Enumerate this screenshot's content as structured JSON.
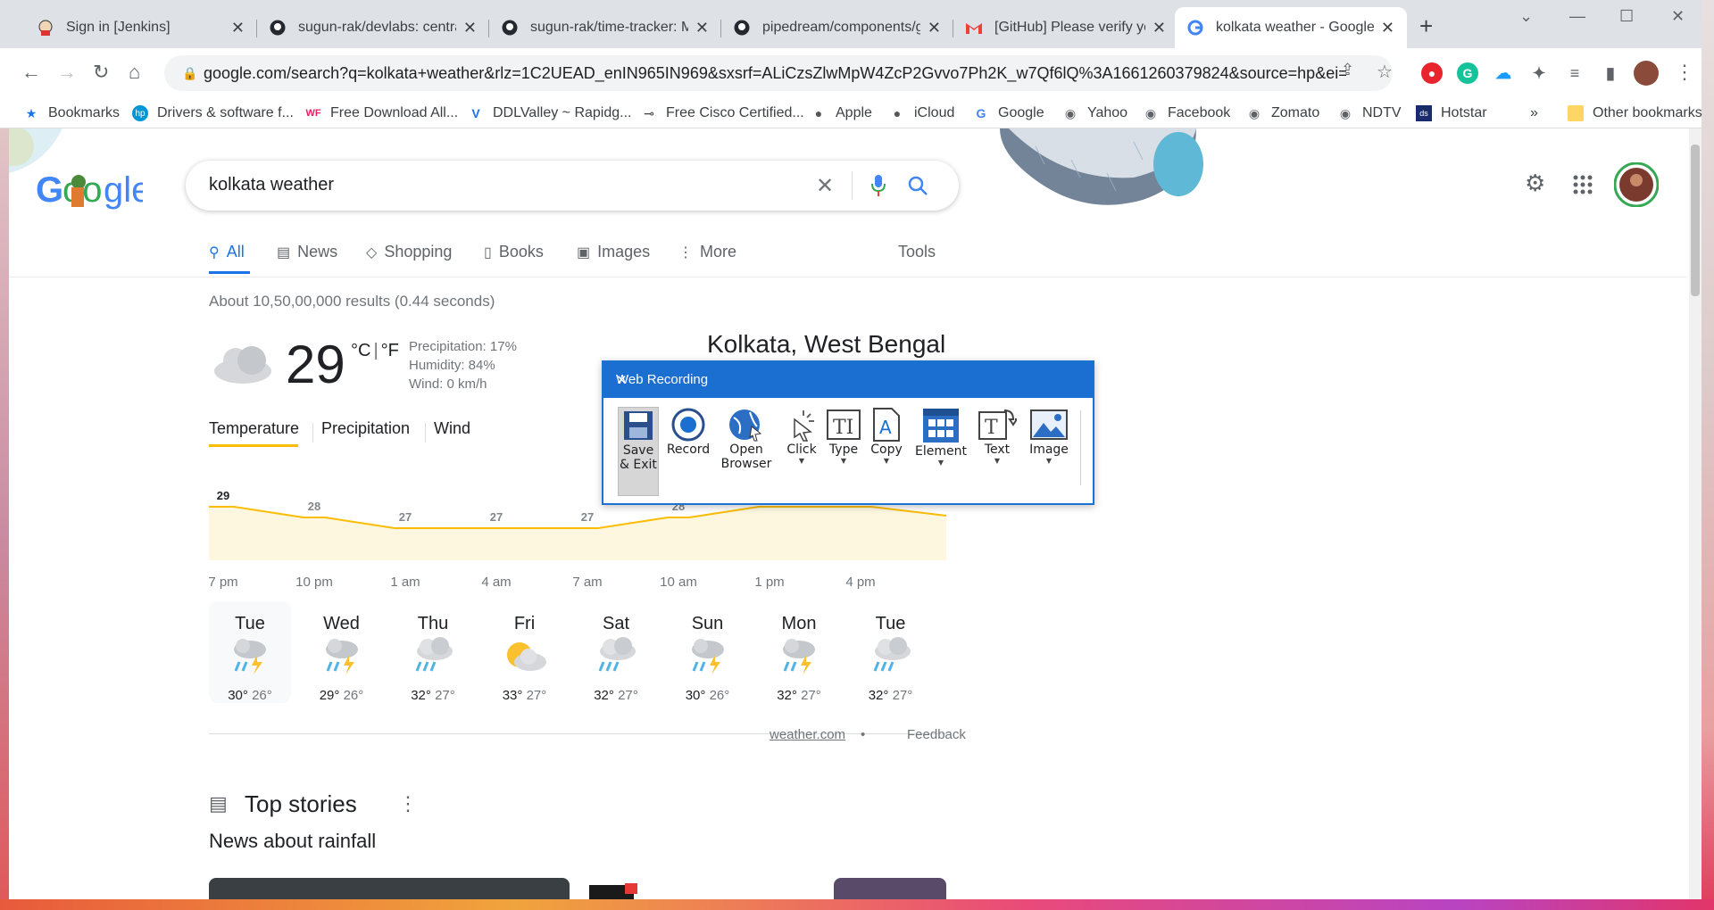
{
  "tabs": [
    {
      "title": "Sign in [Jenkins]",
      "icon": "jenkins-icon"
    },
    {
      "title": "sugun-rak/devlabs: central",
      "icon": "github-icon"
    },
    {
      "title": "sugun-rak/time-tracker: M",
      "icon": "github-icon"
    },
    {
      "title": "pipedream/components/g",
      "icon": "github-icon"
    },
    {
      "title": "[GitHub] Please verify your",
      "icon": "gmail-icon"
    },
    {
      "title": "kolkata weather - Google S",
      "icon": "google-icon"
    }
  ],
  "address": {
    "url": "google.com/search?q=kolkata+weather&rlz=1C2UEAD_enIN965IN969&sxsrf=ALiCzsZlwMpW4ZcP2Gvvo7Ph2K_w7Qf6lQ%3A1661260379824&source=hp&ei=W..."
  },
  "bookmarks": [
    {
      "label": "Bookmarks",
      "icon": "star-icon"
    },
    {
      "label": "Drivers & software f...",
      "icon": "hp-icon"
    },
    {
      "label": "Free Download All...",
      "icon": "wf-icon"
    },
    {
      "label": "DDLValley ~ Rapidg...",
      "icon": "v-icon"
    },
    {
      "label": "Free Cisco Certified...",
      "icon": "key-icon"
    },
    {
      "label": "Apple",
      "icon": "apple-icon"
    },
    {
      "label": "iCloud",
      "icon": "apple-icon"
    },
    {
      "label": "Google",
      "icon": "google-icon"
    },
    {
      "label": "Yahoo",
      "icon": "globe-icon"
    },
    {
      "label": "Facebook",
      "icon": "globe-icon"
    },
    {
      "label": "Zomato",
      "icon": "globe-icon"
    },
    {
      "label": "NDTV",
      "icon": "globe-icon"
    },
    {
      "label": "Hotstar",
      "icon": "hotstar-icon"
    }
  ],
  "bookmarks_more": "»",
  "other_bookmarks": "Other bookmarks",
  "search": {
    "query": "kolkata weather"
  },
  "nav_tabs": [
    {
      "label": "All",
      "icon": "search-icon"
    },
    {
      "label": "News",
      "icon": "news-icon"
    },
    {
      "label": "Shopping",
      "icon": "tag-icon"
    },
    {
      "label": "Books",
      "icon": "book-icon"
    },
    {
      "label": "Images",
      "icon": "image-icon"
    },
    {
      "label": "More",
      "icon": "kebab-icon"
    }
  ],
  "tools_label": "Tools",
  "result_stats": "About 10,50,00,000 results (0.44 seconds)",
  "weather": {
    "temperature": "29",
    "unit_c": "°C",
    "unit_sep": "|",
    "unit_f": "°F",
    "precipitation": "Precipitation: 17%",
    "humidity": "Humidity: 84%",
    "wind": "Wind: 0 km/h",
    "location": "Kolkata, West Bengal",
    "tabs": [
      "Temperature",
      "Precipitation",
      "Wind"
    ],
    "chart_points": [
      29,
      28,
      27,
      27,
      27,
      28,
      29,
      29
    ],
    "hour_labels": [
      "7 pm",
      "10 pm",
      "1 am",
      "4 am",
      "7 am",
      "10 am",
      "1 pm",
      "4 pm"
    ],
    "days": [
      {
        "name": "Tue",
        "hi": "30°",
        "lo": "26°",
        "icon": "thunderstorm-icon"
      },
      {
        "name": "Wed",
        "hi": "29°",
        "lo": "26°",
        "icon": "thunderstorm-icon"
      },
      {
        "name": "Thu",
        "hi": "32°",
        "lo": "27°",
        "icon": "rain-cloud-icon"
      },
      {
        "name": "Fri",
        "hi": "33°",
        "lo": "27°",
        "icon": "partly-cloudy-icon"
      },
      {
        "name": "Sat",
        "hi": "32°",
        "lo": "27°",
        "icon": "rain-cloud-icon"
      },
      {
        "name": "Sun",
        "hi": "30°",
        "lo": "26°",
        "icon": "thunderstorm-icon"
      },
      {
        "name": "Mon",
        "hi": "32°",
        "lo": "27°",
        "icon": "thunderstorm-icon"
      },
      {
        "name": "Tue",
        "hi": "32°",
        "lo": "27°",
        "icon": "rain-cloud-icon"
      }
    ],
    "source": "weather.com",
    "dot": "•",
    "feedback": "Feedback"
  },
  "top_stories": {
    "title": "Top stories",
    "subtitle": "News about rainfall"
  },
  "recorder": {
    "title": "Web Recording",
    "tools": [
      {
        "label": "Save\n& Exit",
        "icon": "floppy-icon"
      },
      {
        "label": "Record",
        "icon": "record-icon"
      },
      {
        "label": "Open\nBrowser",
        "icon": "globe-cursor-icon"
      },
      {
        "label": "Click",
        "icon": "click-icon"
      },
      {
        "label": "Type",
        "icon": "type-icon"
      },
      {
        "label": "Copy",
        "icon": "copy-icon"
      },
      {
        "label": "Element",
        "icon": "element-icon"
      },
      {
        "label": "Text",
        "icon": "text-icon"
      },
      {
        "label": "Image",
        "icon": "image-icon"
      }
    ]
  },
  "colors": {
    "accent": "#1a73e8",
    "temp_line": "#fbbc04",
    "recorder_title": "#1a6fd0"
  }
}
